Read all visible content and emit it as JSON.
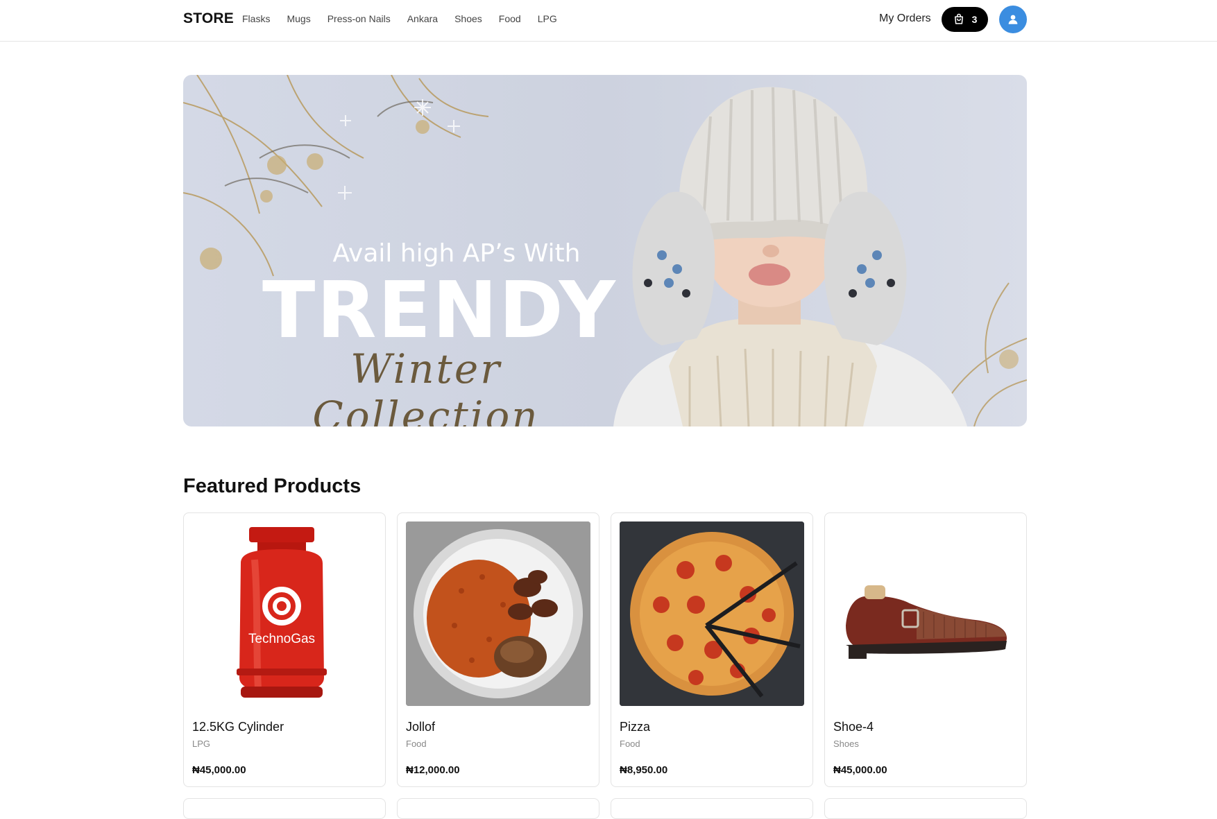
{
  "header": {
    "brand": "STORE",
    "nav": [
      "Flasks",
      "Mugs",
      "Press-on Nails",
      "Ankara",
      "Shoes",
      "Food",
      "LPG"
    ],
    "orders_label": "My Orders",
    "cart_count": "3"
  },
  "banner": {
    "line1": "Avail high AP’s With",
    "line2": "TRENDY",
    "line3": "Winter Collection"
  },
  "featured": {
    "title": "Featured Products",
    "products": [
      {
        "name": "12.5KG Cylinder",
        "category": "LPG",
        "price": "₦45,000.00",
        "image_label": "TechnoGas"
      },
      {
        "name": "Jollof",
        "category": "Food",
        "price": "₦12,000.00"
      },
      {
        "name": "Pizza",
        "category": "Food",
        "price": "₦8,950.00"
      },
      {
        "name": "Shoe-4",
        "category": "Shoes",
        "price": "₦45,000.00"
      }
    ]
  }
}
